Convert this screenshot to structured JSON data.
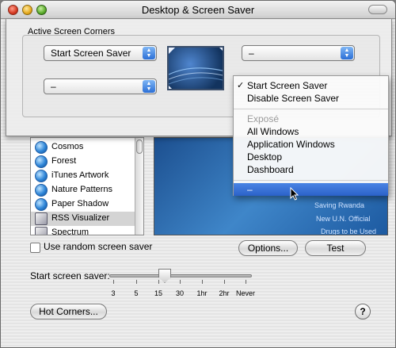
{
  "window": {
    "title": "Desktop & Screen Saver"
  },
  "sheet": {
    "group_title": "Active Screen Corners",
    "top_left_value": "Start Screen Saver",
    "top_right_value": "–",
    "bottom_left_value": "–"
  },
  "menu": {
    "items": [
      {
        "label": "Start Screen Saver",
        "checked": true
      },
      {
        "label": "Disable Screen Saver"
      },
      {
        "label": "Exposé",
        "disabled": true
      },
      {
        "label": "All Windows"
      },
      {
        "label": "Application Windows"
      },
      {
        "label": "Desktop"
      },
      {
        "label": "Dashboard"
      },
      {
        "label": "–",
        "selected": true
      }
    ]
  },
  "screensavers": {
    "items": [
      "Cosmos",
      "Forest",
      "iTunes Artwork",
      "Nature Patterns",
      "Paper Shadow",
      "RSS Visualizer",
      "Spectrum"
    ],
    "selected": "RSS Visualizer"
  },
  "preview": {
    "lines": [
      "Saving Rwanda",
      "New U.N. Official",
      "Drugs to be Used"
    ]
  },
  "options": {
    "random_label": "Use random screen saver",
    "options_button": "Options...",
    "test_button": "Test"
  },
  "slider": {
    "label": "Start screen saver:",
    "ticks": [
      "3",
      "5",
      "15",
      "30",
      "1hr",
      "2hr",
      "Never"
    ],
    "value": "15"
  },
  "bottom": {
    "hot_corners_button": "Hot Corners...",
    "help_glyph": "?"
  }
}
